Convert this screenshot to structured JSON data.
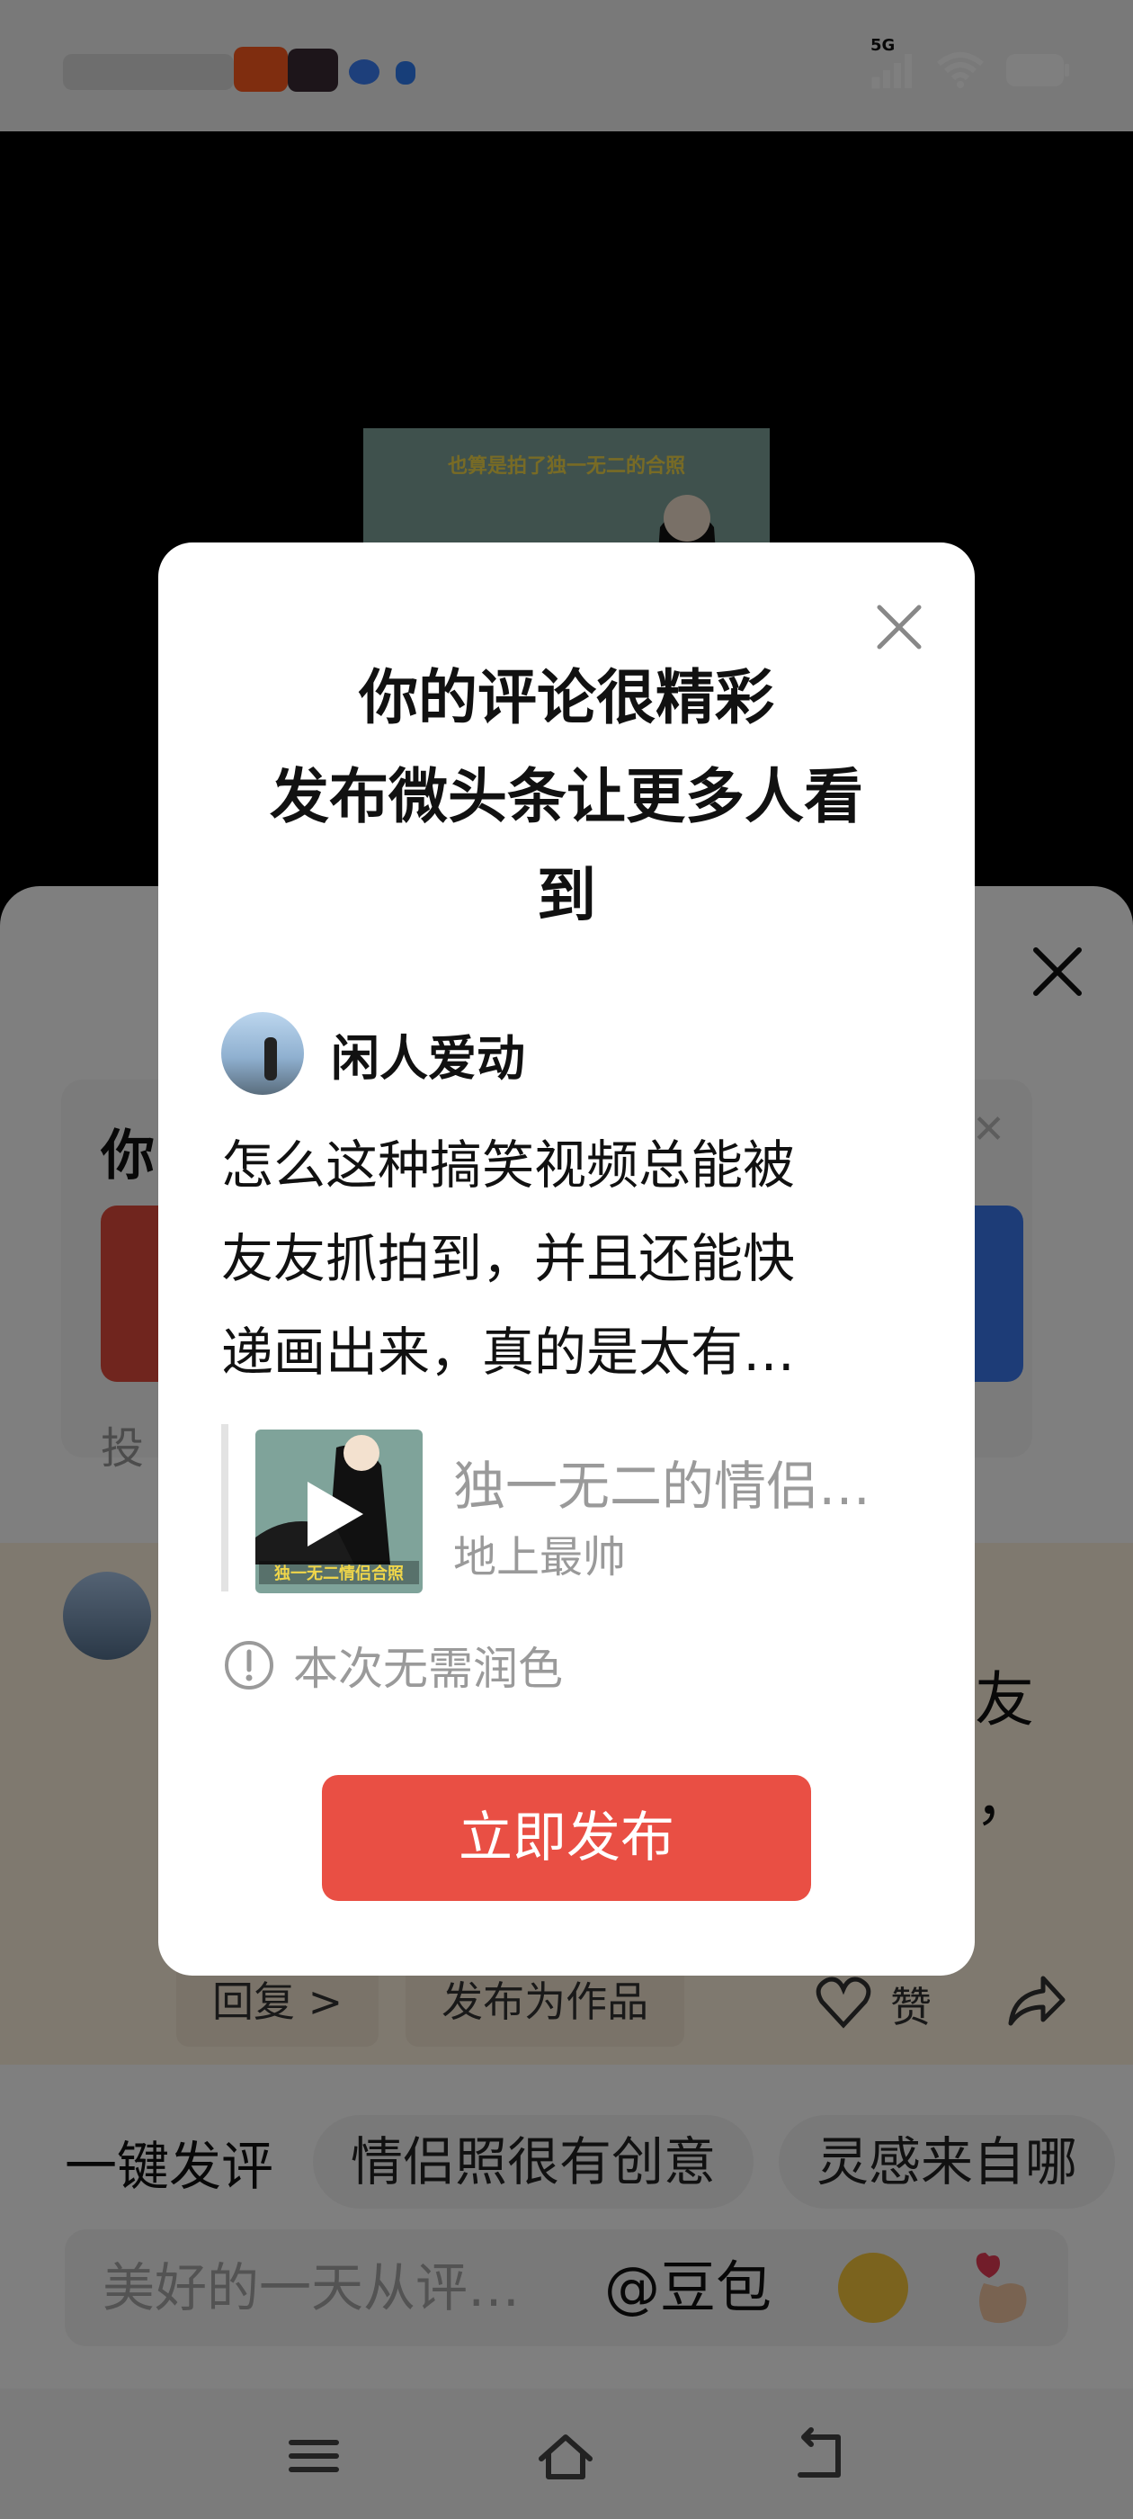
{
  "status_bar": {
    "network": "5G"
  },
  "video": {
    "caption": "也算是拍了独一无二的合照"
  },
  "background_sheet": {
    "promo_title": "你",
    "promo_sub": "投",
    "comment_text_line1": "友",
    "comment_text_line2": "来，",
    "reply_label": "回复 >",
    "publish_work_label": "发布为作品",
    "like_label": "赞"
  },
  "quick_reply": {
    "label": "一键发评",
    "chips": [
      "情侣照很有创意",
      "灵感来自哪"
    ]
  },
  "input_bar": {
    "placeholder": "美好的一天从评…",
    "mention": "@豆包"
  },
  "modal": {
    "title_line1": "你的评论很精彩",
    "title_line2": "发布微头条让更多人看",
    "title_line3": "到",
    "author_name": "闲人爱动",
    "comment_line1": "怎么这种搞笑视频总能被",
    "comment_line2": "友友抓拍到，并且还能快",
    "comment_line3": "递画出来，真的是太有…",
    "quote_title": "独一无二的情侣…",
    "quote_author": "地上最帅",
    "quote_thumb_tag": "独一无二情侣合照",
    "notice": "本次无需润色",
    "publish_button": "立即发布"
  },
  "colors": {
    "publish_button": "#e94f44",
    "overlay": "rgba(0,0,0,0.5)",
    "promo_red": "#e14a3c",
    "promo_blue": "#3a78ee"
  }
}
